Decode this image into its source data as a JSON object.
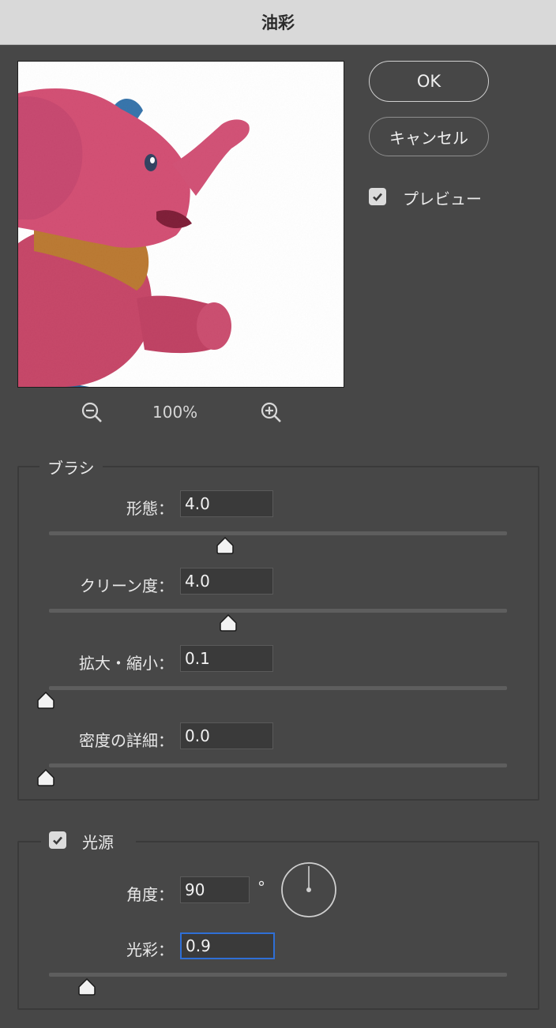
{
  "window": {
    "title": "油彩"
  },
  "actions": {
    "ok_label": "OK",
    "cancel_label": "キャンセル"
  },
  "preview_toggle": {
    "label": "プレビュー",
    "checked": true
  },
  "zoom": {
    "level": "100%"
  },
  "brush": {
    "title": "ブラシ",
    "params": [
      {
        "label": "形態：",
        "value": "4.0",
        "slider": 0.392
      },
      {
        "label": "クリーン度：",
        "value": "4.0",
        "slider": 0.399
      },
      {
        "label": "拡大・縮小：",
        "value": "0.1",
        "slider": 0.0
      },
      {
        "label": "密度の詳細：",
        "value": "0.0",
        "slider": 0.0
      }
    ]
  },
  "lighting": {
    "title": "光源",
    "checked": true,
    "angle": {
      "label": "角度：",
      "value": "90",
      "unit": "°"
    },
    "shine": {
      "label": "光彩：",
      "value": "0.9",
      "slider": 0.09
    }
  },
  "colors": {
    "titlebar": "#d9d9d9",
    "panel": "#474747",
    "focus": "#2f6fd6"
  }
}
